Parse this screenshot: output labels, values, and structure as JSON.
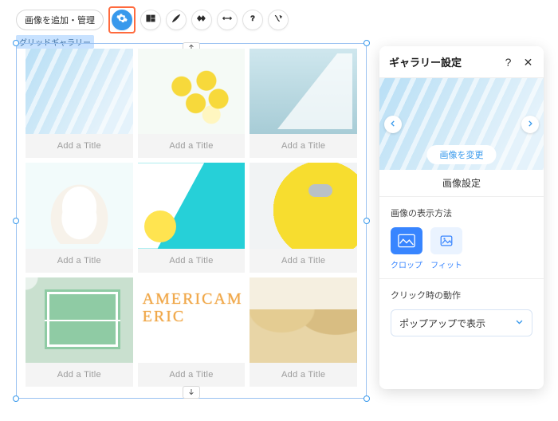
{
  "toolbar": {
    "primary_label": "画像を追加・管理"
  },
  "gallery": {
    "badge": "グリッドギャラリー",
    "captions": [
      "Add a Title",
      "Add a Title",
      "Add a Title",
      "Add a Title",
      "Add a Title",
      "Add a Title",
      "Add a Title",
      "Add a Title",
      "Add a Title"
    ]
  },
  "panel": {
    "title": "ギャラリー設定",
    "change_image": "画像を変更",
    "subhead": "画像設定",
    "display_method_label": "画像の表示方法",
    "opts": {
      "crop": "クロップ",
      "fit": "フィット"
    },
    "click_action_label": "クリック時の動作",
    "click_action_value": "ポップアップで表示"
  }
}
